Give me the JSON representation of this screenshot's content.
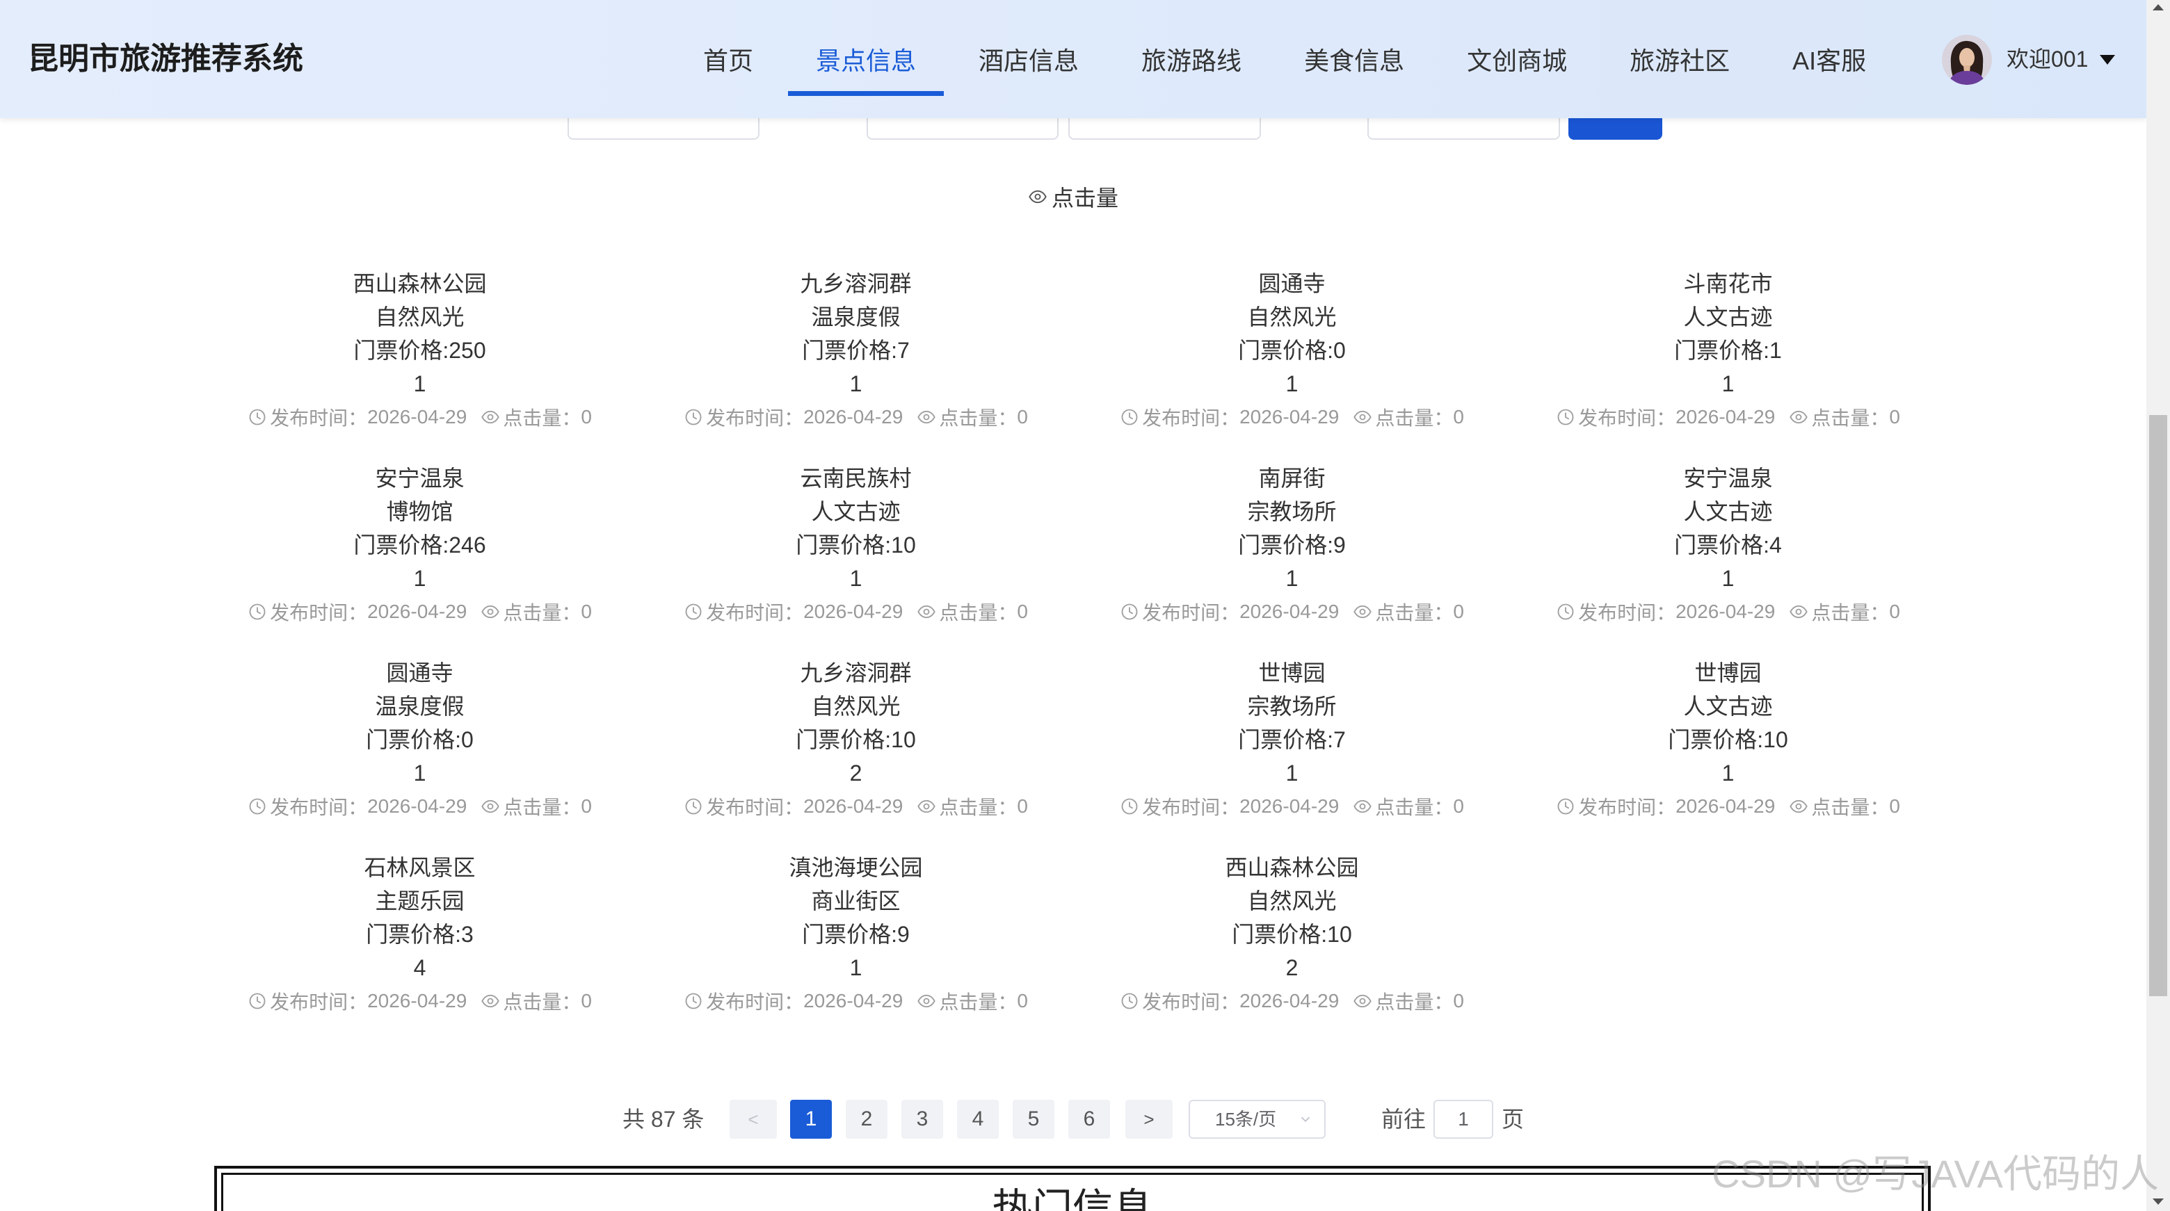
{
  "app": {
    "title": "昆明市旅游推荐系统"
  },
  "nav": {
    "items": [
      {
        "label": "首页",
        "active": false
      },
      {
        "label": "景点信息",
        "active": true
      },
      {
        "label": "酒店信息",
        "active": false
      },
      {
        "label": "旅游路线",
        "active": false
      },
      {
        "label": "美食信息",
        "active": false
      },
      {
        "label": "文创商城",
        "active": false
      },
      {
        "label": "旅游社区",
        "active": false
      },
      {
        "label": "AI客服",
        "active": false
      }
    ]
  },
  "user": {
    "greeting": "欢迎001",
    "avatar_icon": "user-avatar-photo",
    "menu_icon": "caret-down-icon"
  },
  "sort": {
    "label": "点击量",
    "icon": "eye-icon"
  },
  "card_labels": {
    "price": "门票价格:",
    "publish": "发布时间：",
    "clicks": "点击量：",
    "time_icon": "clock-icon",
    "clicks_icon": "eye-icon"
  },
  "attractions": [
    {
      "name": "西山森林公园",
      "category": "自然风光",
      "price": "250",
      "number": "1",
      "publish_date": "2026-04-29",
      "clicks": "0"
    },
    {
      "name": "九乡溶洞群",
      "category": "温泉度假",
      "price": "7",
      "number": "1",
      "publish_date": "2026-04-29",
      "clicks": "0"
    },
    {
      "name": "圆通寺",
      "category": "自然风光",
      "price": "0",
      "number": "1",
      "publish_date": "2026-04-29",
      "clicks": "0"
    },
    {
      "name": "斗南花市",
      "category": "人文古迹",
      "price": "1",
      "number": "1",
      "publish_date": "2026-04-29",
      "clicks": "0"
    },
    {
      "name": "安宁温泉",
      "category": "博物馆",
      "price": "246",
      "number": "1",
      "publish_date": "2026-04-29",
      "clicks": "0"
    },
    {
      "name": "云南民族村",
      "category": "人文古迹",
      "price": "10",
      "number": "1",
      "publish_date": "2026-04-29",
      "clicks": "0"
    },
    {
      "name": "南屏街",
      "category": "宗教场所",
      "price": "9",
      "number": "1",
      "publish_date": "2026-04-29",
      "clicks": "0"
    },
    {
      "name": "安宁温泉",
      "category": "人文古迹",
      "price": "4",
      "number": "1",
      "publish_date": "2026-04-29",
      "clicks": "0"
    },
    {
      "name": "圆通寺",
      "category": "温泉度假",
      "price": "0",
      "number": "1",
      "publish_date": "2026-04-29",
      "clicks": "0"
    },
    {
      "name": "九乡溶洞群",
      "category": "自然风光",
      "price": "10",
      "number": "2",
      "publish_date": "2026-04-29",
      "clicks": "0"
    },
    {
      "name": "世博园",
      "category": "宗教场所",
      "price": "7",
      "number": "1",
      "publish_date": "2026-04-29",
      "clicks": "0"
    },
    {
      "name": "世博园",
      "category": "人文古迹",
      "price": "10",
      "number": "1",
      "publish_date": "2026-04-29",
      "clicks": "0"
    },
    {
      "name": "石林风景区",
      "category": "主题乐园",
      "price": "3",
      "number": "4",
      "publish_date": "2026-04-29",
      "clicks": "0"
    },
    {
      "name": "滇池海埂公园",
      "category": "商业街区",
      "price": "9",
      "number": "1",
      "publish_date": "2026-04-29",
      "clicks": "0"
    },
    {
      "name": "西山森林公园",
      "category": "自然风光",
      "price": "10",
      "number": "2",
      "publish_date": "2026-04-29",
      "clicks": "0"
    }
  ],
  "pagination": {
    "total_text": "共 87 条",
    "prev_label": "<",
    "next_label": ">",
    "pages": [
      {
        "label": "1",
        "active": true
      },
      {
        "label": "2",
        "active": false
      },
      {
        "label": "3",
        "active": false
      },
      {
        "label": "4",
        "active": false
      },
      {
        "label": "5",
        "active": false
      },
      {
        "label": "6",
        "active": false
      }
    ],
    "page_size": "15条/页",
    "goto_label": "前往",
    "goto_value": "1",
    "goto_unit": "页"
  },
  "hot_section": {
    "title": "热门信息"
  },
  "watermark": "CSDN @写JAVA代码的人",
  "colors": {
    "accent": "#1a5cd7",
    "header_bg": "#dde9fb",
    "card_text": "#333333",
    "meta_text": "#999999",
    "search_button": "#1a56d4"
  }
}
